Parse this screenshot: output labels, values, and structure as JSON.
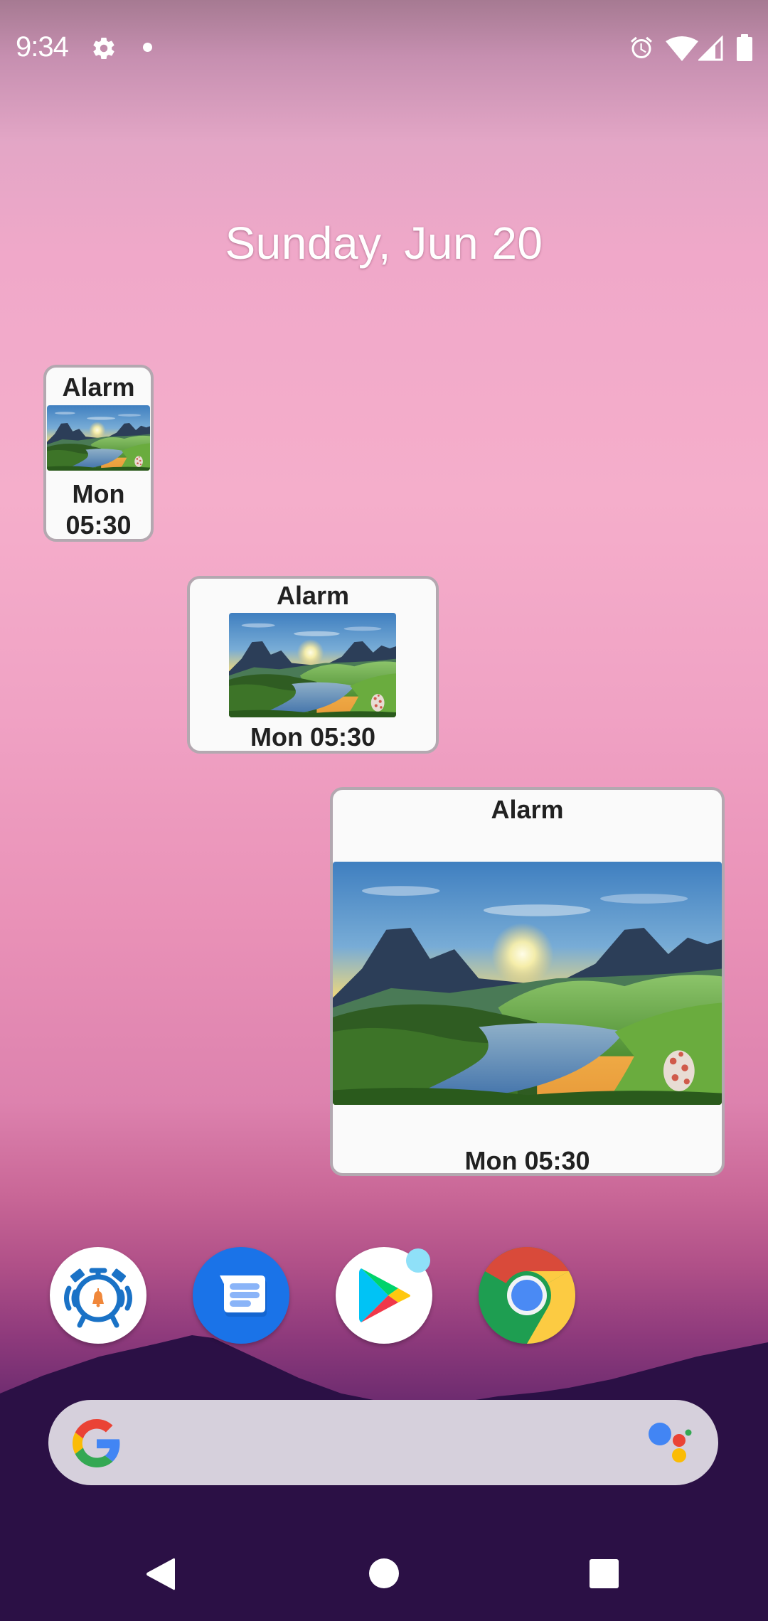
{
  "status_bar": {
    "time": "9:34",
    "left_icons": [
      "settings-gear-icon",
      "notification-dot-icon"
    ],
    "right_icons": [
      "alarm-clock-icon",
      "wifi-icon",
      "cellular-signal-icon",
      "battery-icon"
    ]
  },
  "date_widget": {
    "text": "Sunday, Jun 20"
  },
  "alarm_widgets": [
    {
      "size": "small",
      "title": "Alarm",
      "day": "Mon",
      "time": "05:30",
      "time_full": "Mon 05:30",
      "image": "landscape-river-sunset"
    },
    {
      "size": "medium",
      "title": "Alarm",
      "time_full": "Mon 05:30",
      "image": "landscape-river-sunset"
    },
    {
      "size": "large",
      "title": "Alarm",
      "time_full": "Mon 05:30",
      "image": "landscape-river-sunset"
    }
  ],
  "dock": {
    "apps": [
      {
        "name": "Alarm Clock",
        "icon": "alarm-clock-app-icon"
      },
      {
        "name": "Messages",
        "icon": "messages-app-icon"
      },
      {
        "name": "Play Store",
        "icon": "play-store-app-icon",
        "badge": true
      },
      {
        "name": "Chrome",
        "icon": "chrome-app-icon"
      }
    ]
  },
  "search_bar": {
    "left_icon": "google-g-icon",
    "right_icon": "google-assistant-icon"
  },
  "nav_bar": {
    "buttons": [
      "back",
      "home",
      "recents"
    ]
  },
  "colors": {
    "widget_bg": "#fafafa",
    "widget_border": "#b3a8b0",
    "widget_text": "#212121",
    "alarm_blue": "#1a72c6",
    "bell_orange": "#f0873a",
    "messages_blue": "#1a73e8",
    "play_badge": "#8fe0f8",
    "mountain": "#2b1045"
  }
}
